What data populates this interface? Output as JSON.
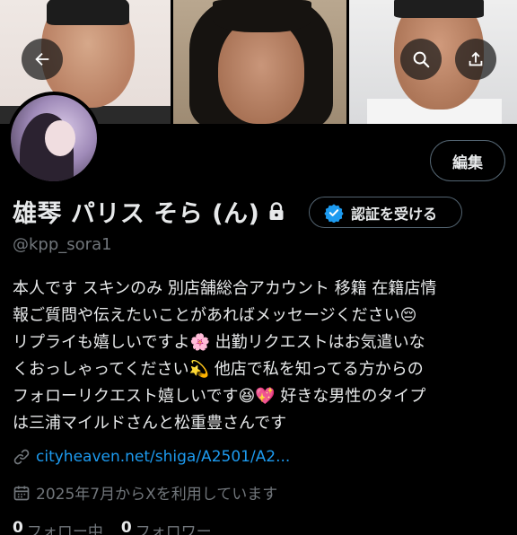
{
  "profile": {
    "display_name": "雄琴 パリス そら (ん)",
    "handle": "@kpp_sora1",
    "edit_label": "編集",
    "verify_label": "認証を受ける",
    "bio_lines": [
      "本人です スキンのみ 別店舗総合アカウント 移籍 在籍店情",
      "報ご質問や伝えたいことがあればメッセージください😔",
      "リプライも嬉しいですよ🌸 出勤リクエストはお気遣いな",
      "くおっしゃってください💫 他店で私を知ってる方からの",
      "フォローリクエスト嬉しいです😆💖 好きな男性のタイプ",
      "は三浦マイルドさんと松重豊さんです"
    ],
    "link": "cityheaven.net/shiga/A2501/A2...",
    "joined": "2025年7月からXを利用しています",
    "following_count": "0",
    "following_label": "フォロー中",
    "followers_count": "0",
    "followers_label": "フォロワー"
  },
  "icons": {
    "back": "back-arrow-icon",
    "search": "search-icon",
    "share": "share-icon",
    "lock": "lock-icon",
    "verified": "verified-badge-icon",
    "link": "link-icon",
    "calendar": "calendar-icon"
  },
  "colors": {
    "background": "#000000",
    "text": "#e7e9ea",
    "muted": "#71767b",
    "link": "#1d9bf0",
    "border": "#536471"
  }
}
